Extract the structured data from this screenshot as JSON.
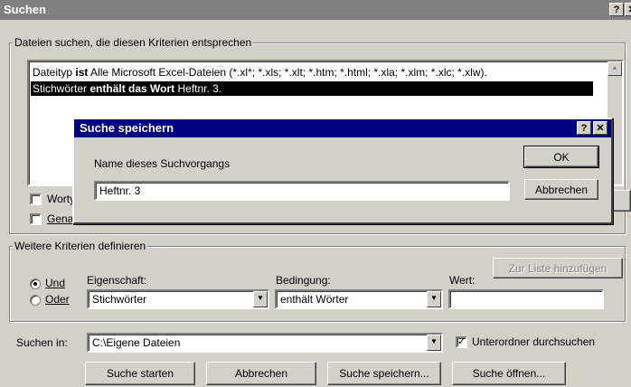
{
  "window": {
    "title": "Suchen",
    "help_btn": "?",
    "close_btn": "✕"
  },
  "criteria": {
    "legend": "Dateien suchen, die diesen Kriterien entsprechen",
    "rows": [
      {
        "pre": "Dateityp ",
        "bold": "ist",
        "post": " Alle Microsoft Excel-Dateien (*.xl*; *.xls; *.xlt; *.htm; *.html; *.xla; *.xlm; *.xlc; *.xlw)."
      },
      {
        "pre": "Stichwörter ",
        "bold": "enthält das Wort",
        "post": " Heftnr. 3."
      }
    ],
    "checkbox1_label": "Worty",
    "checkbox2_label": "Gena"
  },
  "dialog": {
    "title": "Suche speichern",
    "help_btn": "?",
    "close_btn": "✕",
    "name_label": "Name dieses Suchvorgangs",
    "name_value": "Heftnr. 3",
    "ok": "OK",
    "cancel": "Abbrechen"
  },
  "more": {
    "legend": "Weitere Kriterien definieren",
    "radio_and": "Und",
    "radio_or": "Oder",
    "property_label": "Eigenschaft:",
    "property_value": "Stichwörter",
    "condition_label": "Bedingung:",
    "condition_value": "enthält Wörter",
    "value_label": "Wert:",
    "value_value": "",
    "add_button": "Zur Liste hinzufügen"
  },
  "search_in": {
    "label": "Suchen in:",
    "value": "C:\\Eigene Dateien",
    "subfolders_label": "Unterordner durchsuchen",
    "subfolders_checked": true
  },
  "buttons": {
    "start": "Suche starten",
    "cancel": "Abbrechen",
    "save": "Suche speichern...",
    "open": "Suche öffnen..."
  },
  "icons": {
    "dropdown": "triangle-down-icon",
    "scroll_up": "triangle-up-icon",
    "check": "checkmark-icon",
    "close": "close-x-icon"
  }
}
